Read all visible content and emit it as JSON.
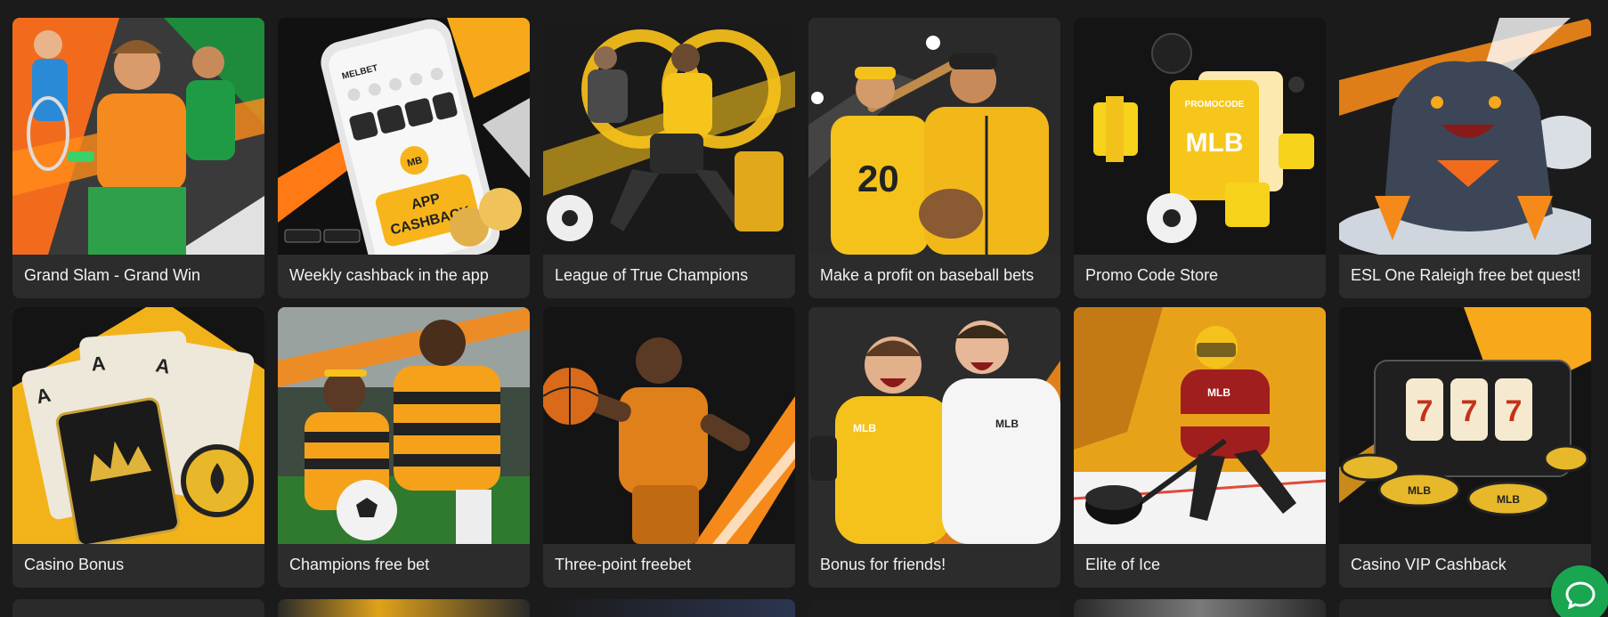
{
  "promotions": [
    {
      "title": "Grand Slam - Grand Win",
      "icon": "tennis-players-art"
    },
    {
      "title": "Weekly cashback in the app",
      "icon": "phone-app-art",
      "art_texts": {
        "brand": "MELBET",
        "badge": "MB",
        "line1": "APP",
        "line2": "CASHBACK"
      }
    },
    {
      "title": "League of True Champions",
      "icon": "football-players-art"
    },
    {
      "title": "Make a profit on baseball bets",
      "icon": "baseball-players-art",
      "art_texts": {
        "jersey": "20"
      }
    },
    {
      "title": "Promo Code Store",
      "icon": "promo-ticket-art",
      "art_texts": {
        "ticket_top": "PROMOCODE",
        "ticket_logo": "MLB"
      }
    },
    {
      "title": "ESL One Raleigh free bet quest!",
      "icon": "monster-art"
    },
    {
      "title": "Casino Bonus",
      "icon": "playing-cards-art",
      "art_texts": {
        "card": "A"
      }
    },
    {
      "title": "Champions free bet",
      "icon": "soccer-players-art"
    },
    {
      "title": "Three-point freebet",
      "icon": "basketball-player-art"
    },
    {
      "title": "Bonus for friends!",
      "icon": "friends-art",
      "art_texts": {
        "shirt": "MLB"
      }
    },
    {
      "title": "Elite of Ice",
      "icon": "hockey-player-art",
      "art_texts": {
        "shirt": "MLB"
      }
    },
    {
      "title": "Casino VIP Cashback",
      "icon": "slot-machine-art",
      "art_texts": {
        "reel": "7",
        "chip": "MLB"
      }
    }
  ],
  "colors": {
    "page_bg": "#1b1b1b",
    "card_bg": "#2c2c2c",
    "accent": "#f7a81b",
    "chat": "#1aa551"
  },
  "chat_button": {
    "icon": "chat-bubble-icon"
  }
}
